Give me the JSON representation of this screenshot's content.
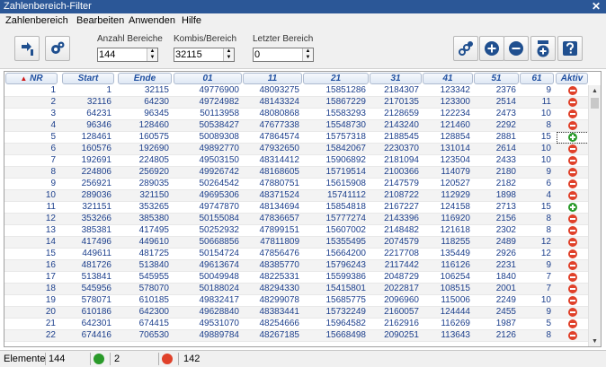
{
  "window": {
    "title": "Zahlenbereich-Filter",
    "close_glyph": "✕"
  },
  "menu": [
    "Zahlenbereich",
    "Bearbeiten",
    "Anwenden",
    "Hilfe"
  ],
  "fields": {
    "anzahl": {
      "label": "Anzahl Bereiche",
      "value": "144"
    },
    "kombis": {
      "label": "Kombis/Bereich",
      "value": "32115"
    },
    "letzter": {
      "label": "Letzter Bereich",
      "value": "0"
    }
  },
  "toolbar_icons": [
    "import-arrow-icon",
    "settings-gears-icon",
    "link-settings-icon",
    "add-icon",
    "remove-icon",
    "add-100-icon",
    "help-icon"
  ],
  "columns": [
    "NR",
    "Start",
    "Ende",
    "01",
    "11",
    "21",
    "31",
    "41",
    "51",
    "61",
    "Aktiv"
  ],
  "sort_indicator": "▲",
  "rows": [
    [
      "1",
      "1",
      "32115",
      "49776900",
      "48093275",
      "15851286",
      "2184307",
      "123342",
      "2376",
      "9",
      "minus"
    ],
    [
      "2",
      "32116",
      "64230",
      "49724982",
      "48143324",
      "15867229",
      "2170135",
      "123300",
      "2514",
      "11",
      "minus"
    ],
    [
      "3",
      "64231",
      "96345",
      "50113958",
      "48080868",
      "15583293",
      "2128659",
      "122234",
      "2473",
      "10",
      "minus"
    ],
    [
      "4",
      "96346",
      "128460",
      "50538427",
      "47677338",
      "15548730",
      "2143240",
      "121460",
      "2292",
      "8",
      "minus"
    ],
    [
      "5",
      "128461",
      "160575",
      "50089308",
      "47864574",
      "15757318",
      "2188545",
      "128854",
      "2881",
      "15",
      "plus"
    ],
    [
      "6",
      "160576",
      "192690",
      "49892770",
      "47932650",
      "15842067",
      "2230370",
      "131014",
      "2614",
      "10",
      "minus"
    ],
    [
      "7",
      "192691",
      "224805",
      "49503150",
      "48314412",
      "15906892",
      "2181094",
      "123504",
      "2433",
      "10",
      "minus"
    ],
    [
      "8",
      "224806",
      "256920",
      "49926742",
      "48168605",
      "15719514",
      "2100366",
      "114079",
      "2180",
      "9",
      "minus"
    ],
    [
      "9",
      "256921",
      "289035",
      "50264542",
      "47880751",
      "15615908",
      "2147579",
      "120527",
      "2182",
      "6",
      "minus"
    ],
    [
      "10",
      "289036",
      "321150",
      "49695306",
      "48371524",
      "15741112",
      "2108722",
      "112929",
      "1898",
      "4",
      "minus"
    ],
    [
      "11",
      "321151",
      "353265",
      "49747870",
      "48134694",
      "15854818",
      "2167227",
      "124158",
      "2713",
      "15",
      "plus"
    ],
    [
      "12",
      "353266",
      "385380",
      "50155084",
      "47836657",
      "15777274",
      "2143396",
      "116920",
      "2156",
      "8",
      "minus"
    ],
    [
      "13",
      "385381",
      "417495",
      "50252932",
      "47899151",
      "15607002",
      "2148482",
      "121618",
      "2302",
      "8",
      "minus"
    ],
    [
      "14",
      "417496",
      "449610",
      "50668856",
      "47811809",
      "15355495",
      "2074579",
      "118255",
      "2489",
      "12",
      "minus"
    ],
    [
      "15",
      "449611",
      "481725",
      "50154724",
      "47856476",
      "15664200",
      "2217708",
      "135449",
      "2926",
      "12",
      "minus"
    ],
    [
      "16",
      "481726",
      "513840",
      "49613674",
      "48385770",
      "15796243",
      "2117442",
      "116126",
      "2231",
      "9",
      "minus"
    ],
    [
      "17",
      "513841",
      "545955",
      "50049948",
      "48225331",
      "15599386",
      "2048729",
      "106254",
      "1840",
      "7",
      "minus"
    ],
    [
      "18",
      "545956",
      "578070",
      "50188024",
      "48294330",
      "15415801",
      "2022817",
      "108515",
      "2001",
      "7",
      "minus"
    ],
    [
      "19",
      "578071",
      "610185",
      "49832417",
      "48299078",
      "15685775",
      "2096960",
      "115006",
      "2249",
      "10",
      "minus"
    ],
    [
      "20",
      "610186",
      "642300",
      "49628840",
      "48383441",
      "15732249",
      "2160057",
      "124444",
      "2455",
      "9",
      "minus"
    ],
    [
      "21",
      "642301",
      "674415",
      "49531070",
      "48254666",
      "15964582",
      "2162916",
      "116269",
      "1987",
      "5",
      "minus"
    ],
    [
      "22",
      "674416",
      "706530",
      "49889784",
      "48267185",
      "15668498",
      "2090251",
      "113643",
      "2126",
      "8",
      "minus"
    ]
  ],
  "status": {
    "label": "Elemente",
    "total": "144",
    "active": "2",
    "inactive": "142"
  },
  "colors": {
    "header_text": "#1f4fa0",
    "active": "#2a9a2a",
    "inactive": "#e0412a",
    "title_bar": "#2b5797"
  }
}
